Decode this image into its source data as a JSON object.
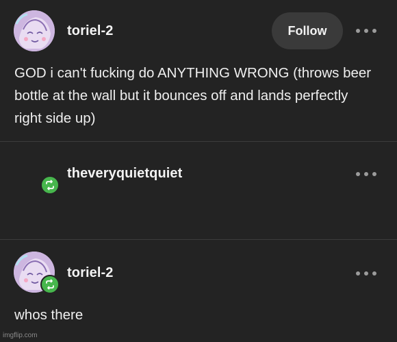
{
  "post1": {
    "username": "toriel-2",
    "follow_label": "Follow",
    "text": "GOD i can't fucking do ANYTHING WRONG (throws beer bottle at the wall but it bounces off and lands perfectly right side up)"
  },
  "post2": {
    "username": "theveryquietquiet"
  },
  "post3": {
    "username": "toriel-2",
    "text": "whos there"
  },
  "watermark": "imgflip.com",
  "colors": {
    "background": "#232323",
    "follow_button": "#3a3a3a",
    "reblog_green": "#47b64d",
    "divider": "#3c3c3c"
  },
  "icons": {
    "more": "more-options-icon",
    "reblog": "reblog-icon",
    "avatar": "user-avatar"
  }
}
